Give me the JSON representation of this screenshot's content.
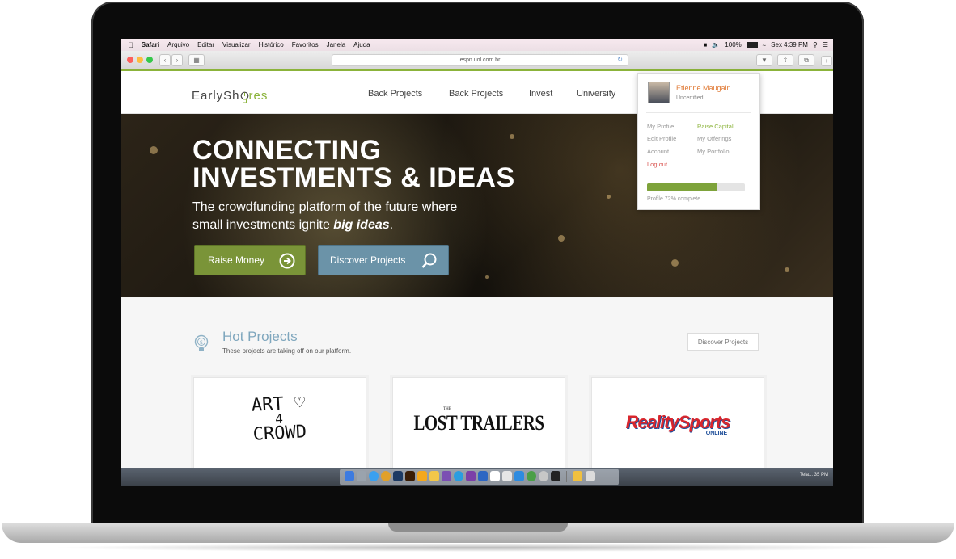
{
  "menubar": {
    "app": "Safari",
    "items": [
      "Arquivo",
      "Editar",
      "Visualizar",
      "Histórico",
      "Favoritos",
      "Janela",
      "Ajuda"
    ],
    "battery": "100%",
    "clock": "Sex 4:39 PM"
  },
  "browser": {
    "url": "espn.uol.com.br"
  },
  "site": {
    "logo_prefix": "EarlySh",
    "logo_suffix": "res",
    "nav": [
      "Back Projects",
      "Back Projects",
      "Invest",
      "University"
    ]
  },
  "hero": {
    "title_line1": "CONNECTING",
    "title_line2": "INVESTMENTS & IDEAS",
    "subtitle_line1": "The crowdfunding platform of the future where",
    "subtitle_line2_prefix": "small investments ignite ",
    "subtitle_line2_em": "big ideas",
    "subtitle_line2_suffix": ".",
    "raise_label": "Raise Money",
    "discover_label": "Discover Projects"
  },
  "user_menu": {
    "name": "Etienne Maugain",
    "status": "Uncertified",
    "left_links": [
      "My Profile",
      "Edit Profile",
      "Account"
    ],
    "logout": "Log out",
    "right_links": [
      "Raise Capital",
      "My Offerings",
      "My Portfolio"
    ],
    "profile_progress": 0.72,
    "progress_text": "Profile 72% complete."
  },
  "hot_projects": {
    "title": "Hot Projects",
    "subtitle": "These projects are taking off on our platform.",
    "button": "Discover Projects",
    "cards": [
      {
        "line1": "ART ♡",
        "line2": "4",
        "line3": "CROWD"
      },
      {
        "the": "THE",
        "name": "LOST TRAILERS"
      },
      {
        "name": "RealitySports",
        "tag": "ONLINE"
      }
    ]
  },
  "dock": {
    "label": "Tela... 35 PM"
  },
  "colors": {
    "accent_green": "#8bb33a",
    "raise_button": "#7a9438",
    "discover_button": "#6b93a8",
    "user_name": "#e07a35",
    "logout": "#d9534f",
    "raise_capital": "#8bb33a",
    "hot_title": "#7ea6bd"
  }
}
